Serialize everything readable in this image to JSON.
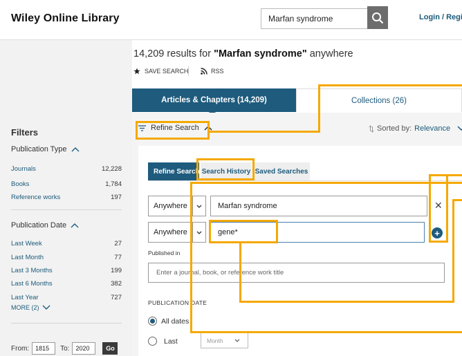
{
  "header": {
    "logo": "Wiley Online Library",
    "search_value": "Marfan syndrome",
    "login": "Login / Registe"
  },
  "results": {
    "count_text": "14,209 results for ",
    "query": "\"Marfan syndrome\"",
    "suffix": " anywhere",
    "save_search": "SAVE SEARCH",
    "rss": "RSS"
  },
  "tabs": {
    "articles": "Articles & Chapters (14,209)",
    "collections": "Collections (26)"
  },
  "filters": {
    "title": "Filters",
    "publication_type": {
      "title": "Publication Type",
      "items": [
        {
          "label": "Journals",
          "count": "12,228"
        },
        {
          "label": "Books",
          "count": "1,784"
        },
        {
          "label": "Reference works",
          "count": "197"
        }
      ]
    },
    "publication_date": {
      "title": "Publication Date",
      "items": [
        {
          "label": "Last Week",
          "count": "27"
        },
        {
          "label": "Last Month",
          "count": "77"
        },
        {
          "label": "Last 3 Months",
          "count": "199"
        },
        {
          "label": "Last 6 Months",
          "count": "382"
        },
        {
          "label": "Last Year",
          "count": "727"
        }
      ],
      "more": "MORE (2)"
    },
    "range": {
      "from_label": "From:",
      "from_value": "1815",
      "to_label": "To:",
      "to_value": "2020",
      "go": "Go"
    }
  },
  "refine": {
    "toggle_label": "Refine Search",
    "sorted_label": "Sorted by:",
    "sorted_value": "Relevance",
    "subtabs": {
      "refine": "Refine Search",
      "history": "Search History",
      "saved": "Saved Searches"
    },
    "rows": [
      {
        "field": "Anywhere",
        "value": "Marfan syndrome"
      },
      {
        "field": "Anywhere",
        "value": "gene*"
      }
    ],
    "published_in_label": "Published in",
    "published_in_placeholder": "Enter a journal, book, or reference work title",
    "pub_date_label": "PUBLICATION DATE",
    "radio_all": "All dates",
    "radio_last": "Last",
    "month_placeholder": "Month"
  },
  "colors": {
    "brand_blue": "#1e5b7d",
    "highlight": "#f5a800"
  }
}
